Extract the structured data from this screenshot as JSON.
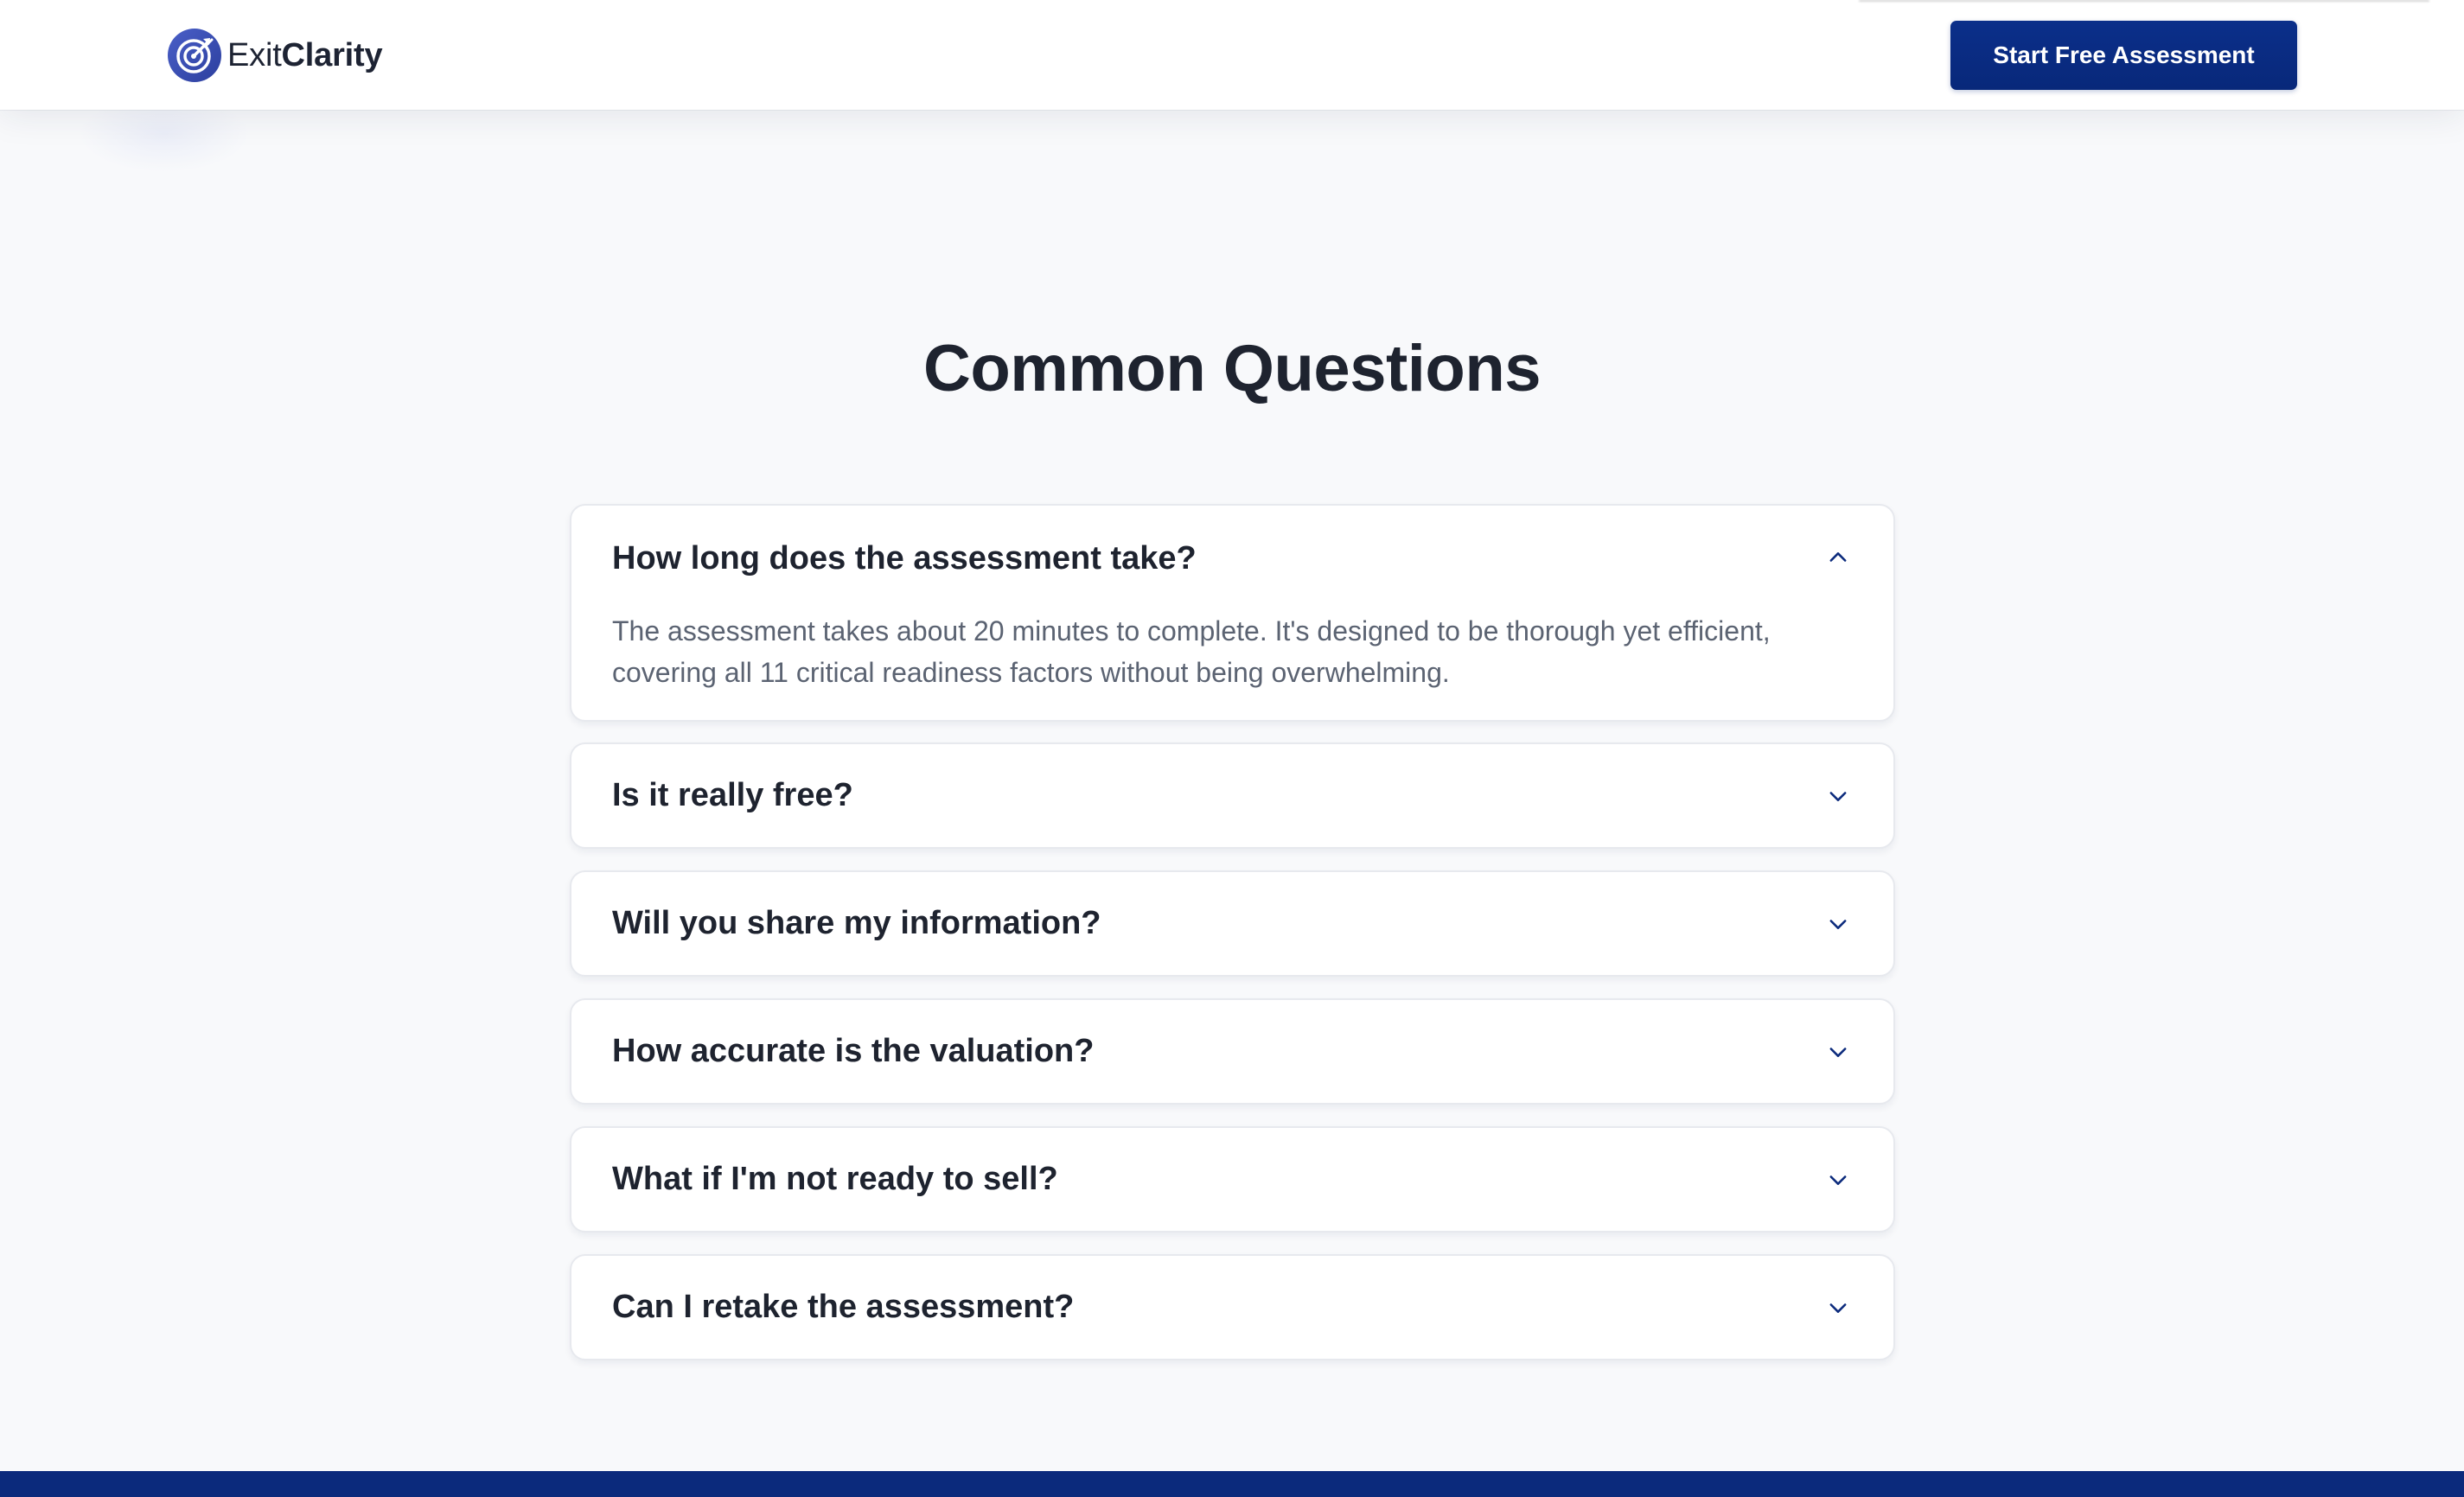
{
  "header": {
    "logo": {
      "icon": "target-icon",
      "text_light": "Exit",
      "text_bold": "Clarity"
    },
    "cta_label": "Start Free Assessment"
  },
  "faq": {
    "title": "Common Questions",
    "items": [
      {
        "question": "How long does the assessment take?",
        "answer": "The assessment takes about 20 minutes to complete. It's designed to be thorough yet efficient, covering all 11 critical readiness factors without being overwhelming.",
        "expanded": true,
        "icon": "chevron-up-icon"
      },
      {
        "question": "Is it really free?",
        "expanded": false,
        "icon": "chevron-down-icon"
      },
      {
        "question": "Will you share my information?",
        "expanded": false,
        "icon": "chevron-down-icon"
      },
      {
        "question": "How accurate is the valuation?",
        "expanded": false,
        "icon": "chevron-down-icon"
      },
      {
        "question": "What if I'm not ready to sell?",
        "expanded": false,
        "icon": "chevron-down-icon"
      },
      {
        "question": "Can I retake the assessment?",
        "expanded": false,
        "icon": "chevron-down-icon"
      }
    ]
  },
  "colors": {
    "brand_primary": "#0a2d85",
    "background": "#f8f9fb",
    "card": "#ffffff",
    "heading": "#1e232f",
    "body_text": "#5b6372",
    "footer": "#0b2a7c"
  }
}
